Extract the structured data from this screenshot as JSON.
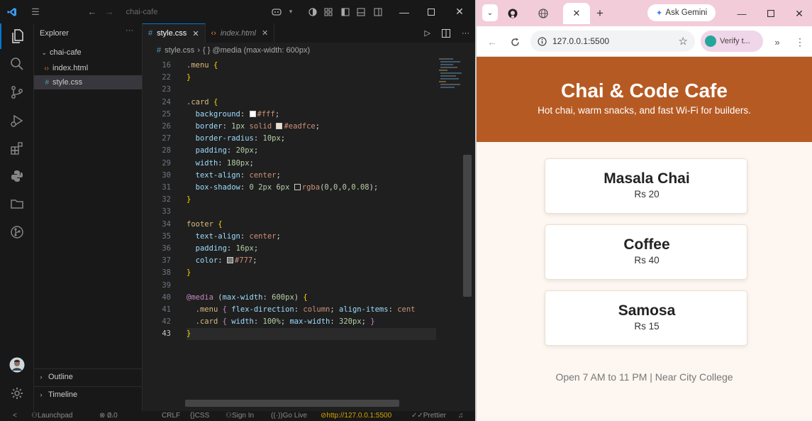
{
  "vscode": {
    "title": "chai-cafe",
    "explorer": {
      "header": "Explorer",
      "folder": "chai-cafe",
      "files": [
        {
          "name": "index.html",
          "icon": "html-file-icon"
        },
        {
          "name": "style.css",
          "icon": "css-file-icon",
          "selected": true
        }
      ],
      "outline": "Outline",
      "timeline": "Timeline"
    },
    "tabs": [
      {
        "label": "style.css",
        "active": true
      },
      {
        "label": "index.html",
        "active": false
      }
    ],
    "breadcrumb": {
      "file": "style.css",
      "symbol": "{ } @media (max-width: 600px)"
    },
    "code_lines": [
      {
        "n": "16",
        "html": "<span class=\"sel-c\">.menu</span> <span class=\"br\">{</span>"
      },
      {
        "n": "22",
        "html": "<span class=\"br\">}</span>"
      },
      {
        "n": "23",
        "html": ""
      },
      {
        "n": "24",
        "html": "<span class=\"sel-c\">.card</span> <span class=\"br\">{</span>"
      },
      {
        "n": "25",
        "html": "  <span class=\"prop\">background</span>: <span class=\"sw\" style=\"background:#fff\"></span><span class=\"val\">#fff</span>;"
      },
      {
        "n": "26",
        "html": "  <span class=\"prop\">border</span>: <span class=\"num\">1px</span> <span class=\"val\">solid</span> <span class=\"sw\" style=\"background:#eadfce\"></span><span class=\"val\">#eadfce</span>;"
      },
      {
        "n": "27",
        "html": "  <span class=\"prop\">border-radius</span>: <span class=\"num\">10px</span>;"
      },
      {
        "n": "28",
        "html": "  <span class=\"prop\">padding</span>: <span class=\"num\">20px</span>;"
      },
      {
        "n": "29",
        "html": "  <span class=\"prop\">width</span>: <span class=\"num\">180px</span>;"
      },
      {
        "n": "30",
        "html": "  <span class=\"prop\">text-align</span>: <span class=\"val\">center</span>;"
      },
      {
        "n": "31",
        "html": "  <span class=\"prop\">box-shadow</span>: <span class=\"num\">0 2px 6px</span> <span class=\"sw\" style=\"background:#1f1f1f\"></span><span class=\"val\">rgba</span>(<span class=\"num\">0,0,0,0.08</span>);"
      },
      {
        "n": "32",
        "html": "<span class=\"br\">}</span>"
      },
      {
        "n": "33",
        "html": ""
      },
      {
        "n": "34",
        "html": "<span class=\"sel-c\">footer</span> <span class=\"br\">{</span>"
      },
      {
        "n": "35",
        "html": "  <span class=\"prop\">text-align</span>: <span class=\"val\">center</span>;"
      },
      {
        "n": "36",
        "html": "  <span class=\"prop\">padding</span>: <span class=\"num\">16px</span>;"
      },
      {
        "n": "37",
        "html": "  <span class=\"prop\">color</span>: <span class=\"sw\" style=\"background:#777\"></span><span class=\"val\">#777</span>;"
      },
      {
        "n": "38",
        "html": "<span class=\"br\">}</span>"
      },
      {
        "n": "39",
        "html": ""
      },
      {
        "n": "40",
        "html": "<span class=\"kw\">@media</span> (<span class=\"prop\">max-width</span>: <span class=\"num\">600px</span>) <span class=\"br\">{</span>"
      },
      {
        "n": "41",
        "html": "  <span class=\"sel-c\">.menu</span> <span class=\"kw\">{</span> <span class=\"prop\">flex-direction</span>: <span class=\"val\">column</span>; <span class=\"prop\">align-items</span>: <span class=\"val\">cent</span>"
      },
      {
        "n": "42",
        "html": "  <span class=\"sel-c\">.card</span> <span class=\"kw\">{</span> <span class=\"prop\">width</span>: <span class=\"num\">100%</span>; <span class=\"prop\">max-width</span>: <span class=\"num\">320px</span>; <span class=\"kw\">}</span>"
      },
      {
        "n": "43",
        "html": "<span class=\"br\">}</span>",
        "current": true
      }
    ],
    "status": {
      "launchpad": "Launchpad",
      "problems": "0",
      "warnings": "0",
      "eol": "CRLF",
      "lang": "CSS",
      "signin": "Sign In",
      "golive": "Go Live",
      "server": "http://127.0.0.1:5500",
      "prettier": "Prettier"
    }
  },
  "chrome": {
    "tab_gemini": "Ask Gemini",
    "address": "127.0.0.1:5500",
    "verify": "Verify t..."
  },
  "site": {
    "title": "Chai & Code Cafe",
    "tagline": "Hot chai, warm snacks, and fast Wi-Fi for builders.",
    "menu": [
      {
        "name": "Masala Chai",
        "price": "Rs 20"
      },
      {
        "name": "Coffee",
        "price": "Rs 40"
      },
      {
        "name": "Samosa",
        "price": "Rs 15"
      }
    ],
    "footer": "Open 7 AM to 11 PM | Near City College",
    "colors": {
      "header": "#b65a23",
      "page_bg": "#fdf6f1",
      "card_border": "#eadfce"
    }
  }
}
